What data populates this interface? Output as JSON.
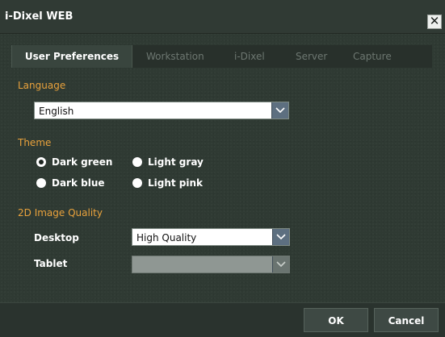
{
  "window": {
    "title": "i-Dixel WEB"
  },
  "tabs": [
    {
      "label": "User Preferences"
    },
    {
      "label": "Workstation"
    },
    {
      "label": "i-Dixel"
    },
    {
      "label": "Server"
    },
    {
      "label": "Capture"
    }
  ],
  "language": {
    "section_label": "Language",
    "selected": "English"
  },
  "theme": {
    "section_label": "Theme",
    "options": [
      {
        "label": "Dark green",
        "checked": true
      },
      {
        "label": "Light gray",
        "checked": false
      },
      {
        "label": "Dark blue",
        "checked": false
      },
      {
        "label": "Light pink",
        "checked": false
      }
    ]
  },
  "image_quality": {
    "section_label": "2D Image Quality",
    "desktop_label": "Desktop",
    "desktop_value": "High Quality",
    "tablet_label": "Tablet",
    "tablet_value": ""
  },
  "buttons": {
    "ok": "OK",
    "cancel": "Cancel"
  }
}
